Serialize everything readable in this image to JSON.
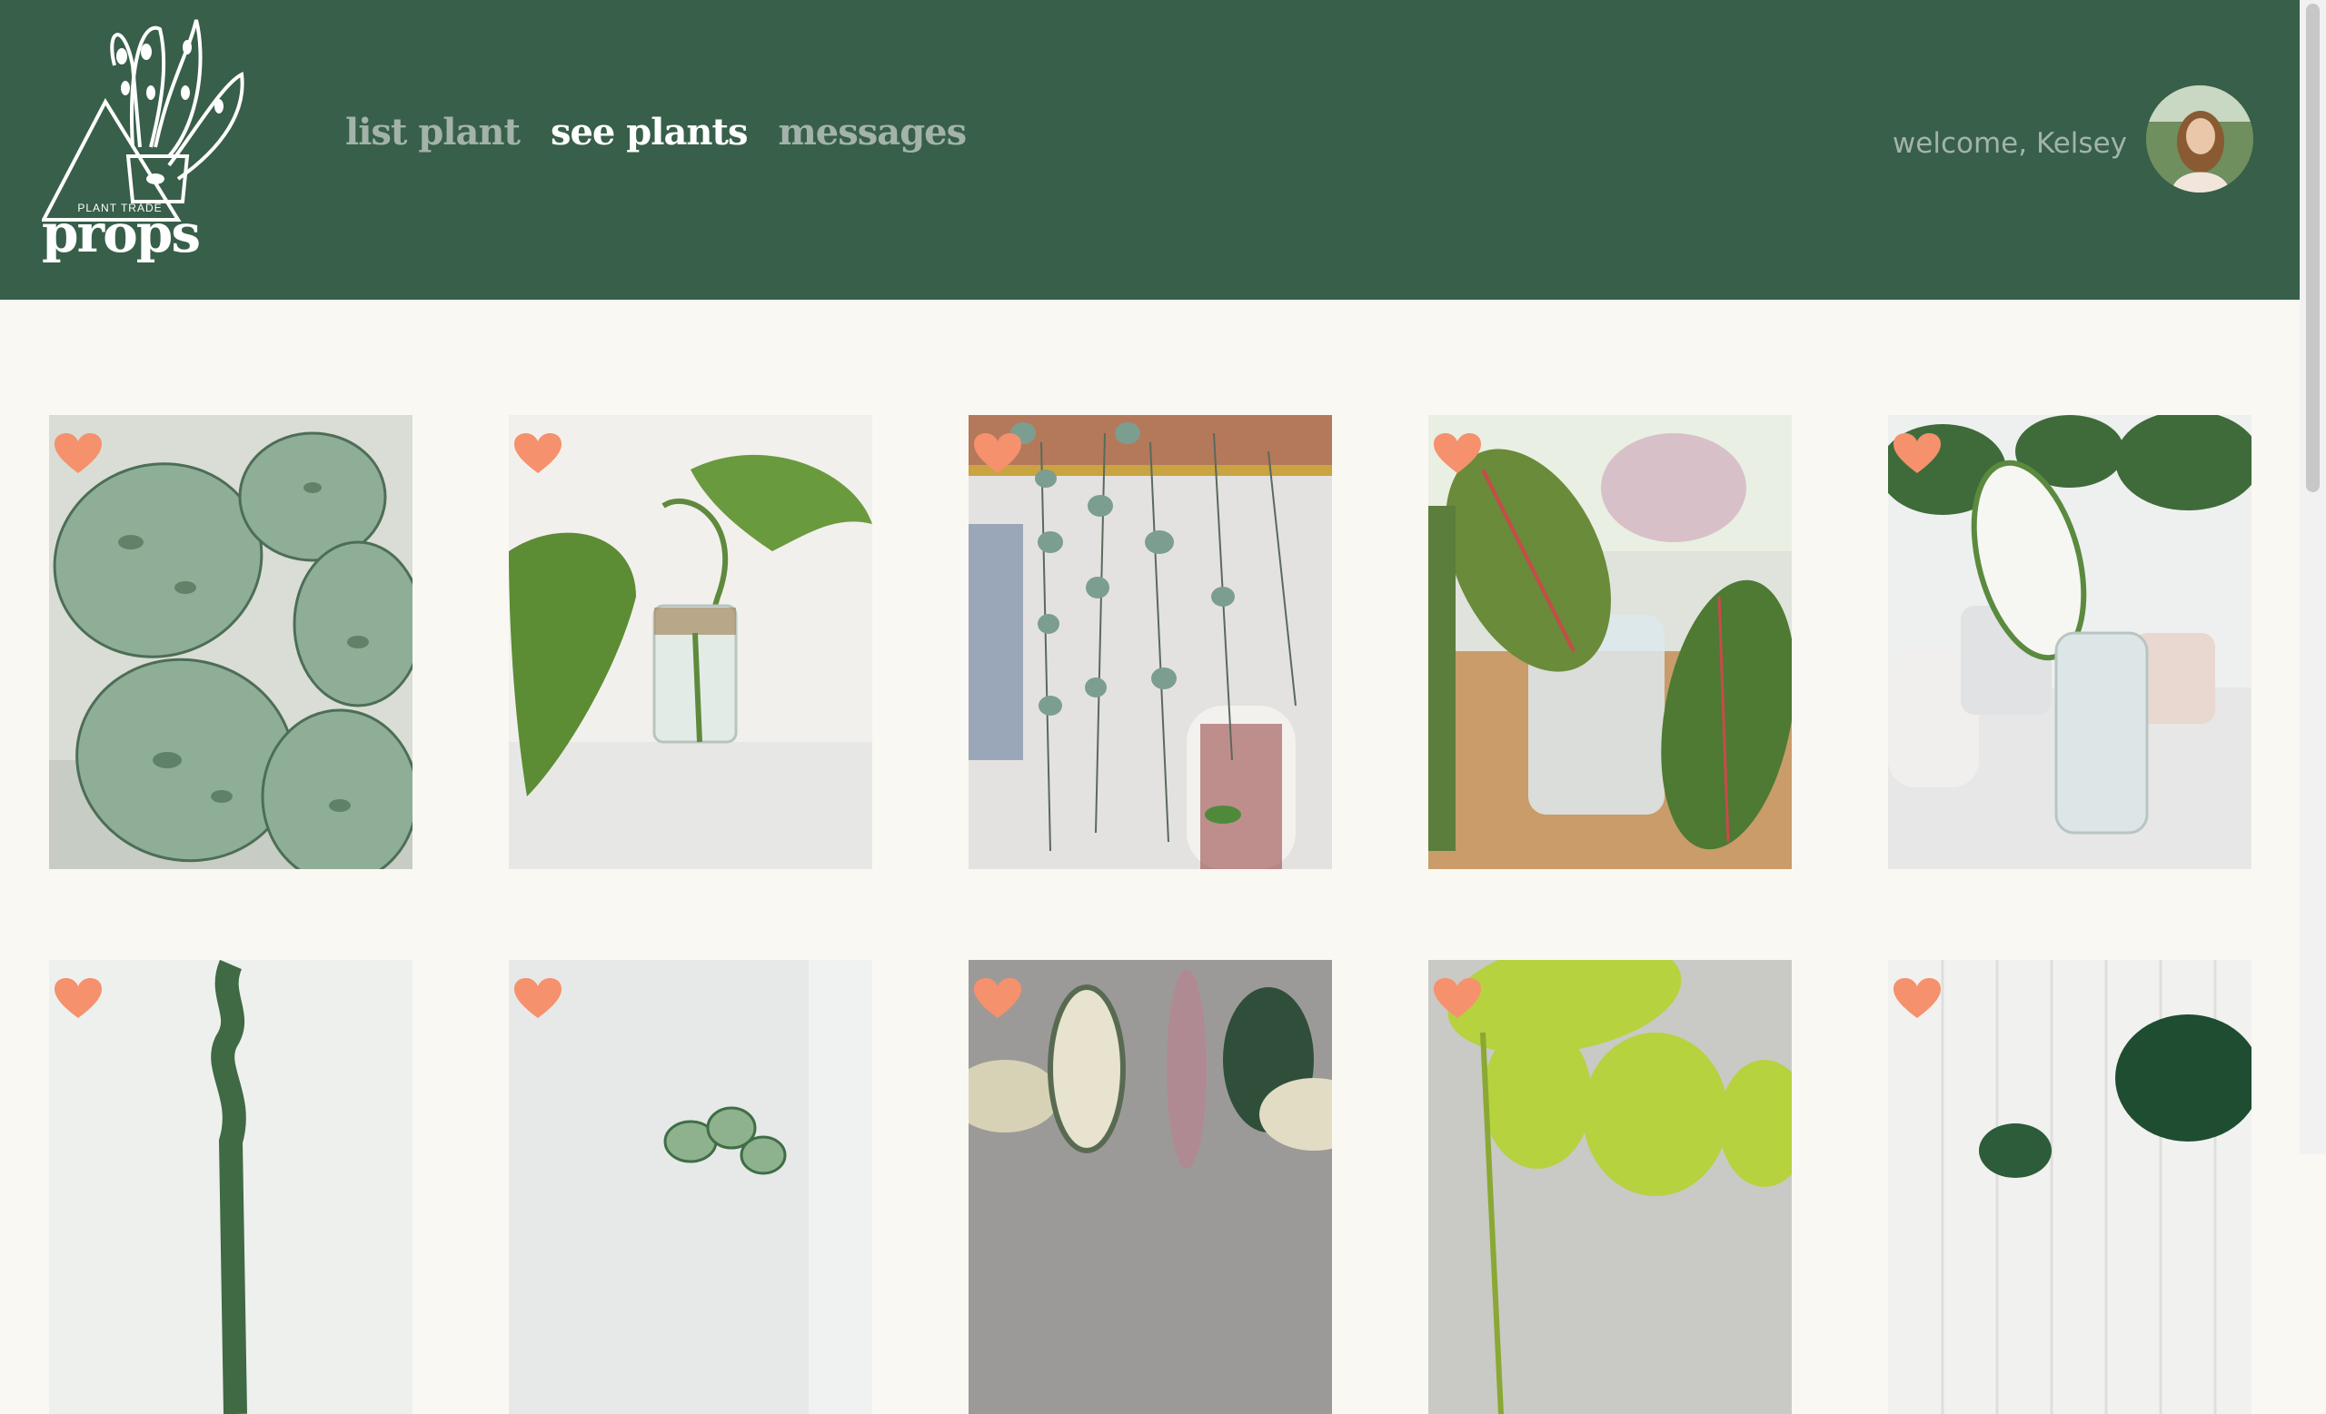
{
  "app": {
    "logo_text": "props",
    "logo_tagline": "PLANT TRADE"
  },
  "nav": {
    "items": [
      {
        "label": "list plant",
        "active": false
      },
      {
        "label": "see plants",
        "active": true
      },
      {
        "label": "messages",
        "active": false
      }
    ]
  },
  "user": {
    "welcome_text": "welcome, Kelsey"
  },
  "colors": {
    "header_bg": "#375f49",
    "page_bg": "#faf8f3",
    "nav_active": "#ffffff",
    "nav_inactive": "#a3b3a9",
    "heart": "#f5916c"
  },
  "plant_cards": [
    {
      "photo": "satin-pothos",
      "favorite_icon": "heart-icon"
    },
    {
      "photo": "mini-monstera-cutting",
      "favorite_icon": "heart-icon"
    },
    {
      "photo": "string-of-hearts",
      "favorite_icon": "heart-icon"
    },
    {
      "photo": "prayer-plant-in-jar",
      "favorite_icon": "heart-icon"
    },
    {
      "photo": "variegated-monstera-cutting",
      "favorite_icon": "heart-icon"
    },
    {
      "photo": "wavy-leaf-plant",
      "favorite_icon": "heart-icon"
    },
    {
      "photo": "watermelon-peperomia",
      "favorite_icon": "heart-icon"
    },
    {
      "photo": "variegated-rubber-plant",
      "favorite_icon": "heart-icon"
    },
    {
      "photo": "neon-pothos",
      "favorite_icon": "heart-icon"
    },
    {
      "photo": "monstera",
      "favorite_icon": "heart-icon"
    }
  ]
}
